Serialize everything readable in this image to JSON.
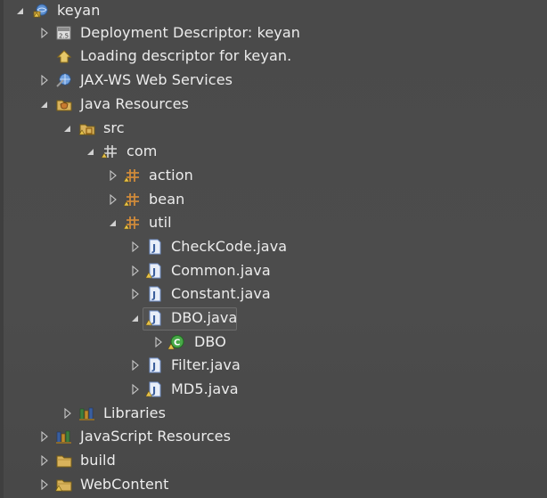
{
  "tree": {
    "items": [
      {
        "label": "keyan",
        "icon": "web-project-icon",
        "expanded": true
      },
      {
        "label": "Deployment Descriptor: keyan",
        "icon": "deployment-descriptor-icon",
        "expanded": false
      },
      {
        "label": "Loading descriptor for keyan.",
        "icon": "loading-icon",
        "expanded": null
      },
      {
        "label": "JAX-WS Web Services",
        "icon": "web-services-icon",
        "expanded": false
      },
      {
        "label": "Java Resources",
        "icon": "java-resources-icon",
        "expanded": true
      },
      {
        "label": "src",
        "icon": "source-folder-icon",
        "expanded": true
      },
      {
        "label": "com",
        "icon": "package-icon",
        "expanded": true
      },
      {
        "label": "action",
        "icon": "package-icon",
        "expanded": false
      },
      {
        "label": "bean",
        "icon": "package-icon",
        "expanded": false
      },
      {
        "label": "util",
        "icon": "package-icon",
        "expanded": true
      },
      {
        "label": "CheckCode.java",
        "icon": "java-file-icon",
        "expanded": false
      },
      {
        "label": "Common.java",
        "icon": "java-file-warning-icon",
        "expanded": false
      },
      {
        "label": "Constant.java",
        "icon": "java-file-icon",
        "expanded": false
      },
      {
        "label": "DBO.java",
        "icon": "java-file-warning-icon",
        "expanded": true,
        "selected": true
      },
      {
        "label": "DBO",
        "icon": "class-icon",
        "expanded": false
      },
      {
        "label": "Filter.java",
        "icon": "java-file-icon",
        "expanded": false
      },
      {
        "label": "MD5.java",
        "icon": "java-file-warning-icon",
        "expanded": false
      },
      {
        "label": "Libraries",
        "icon": "libraries-icon",
        "expanded": false
      },
      {
        "label": "JavaScript Resources",
        "icon": "javascript-resources-icon",
        "expanded": false
      },
      {
        "label": "build",
        "icon": "folder-icon",
        "expanded": false
      },
      {
        "label": "WebContent",
        "icon": "folder-warning-icon",
        "expanded": false
      }
    ]
  },
  "colors": {
    "background": "#4b4b4b",
    "text": "#ececec",
    "twisty": "#d0d0d0",
    "package_orange": "#d08a3a",
    "java_blue": "#6f8fc8",
    "class_green": "#48a848",
    "warning_yellow": "#e6c24a"
  }
}
